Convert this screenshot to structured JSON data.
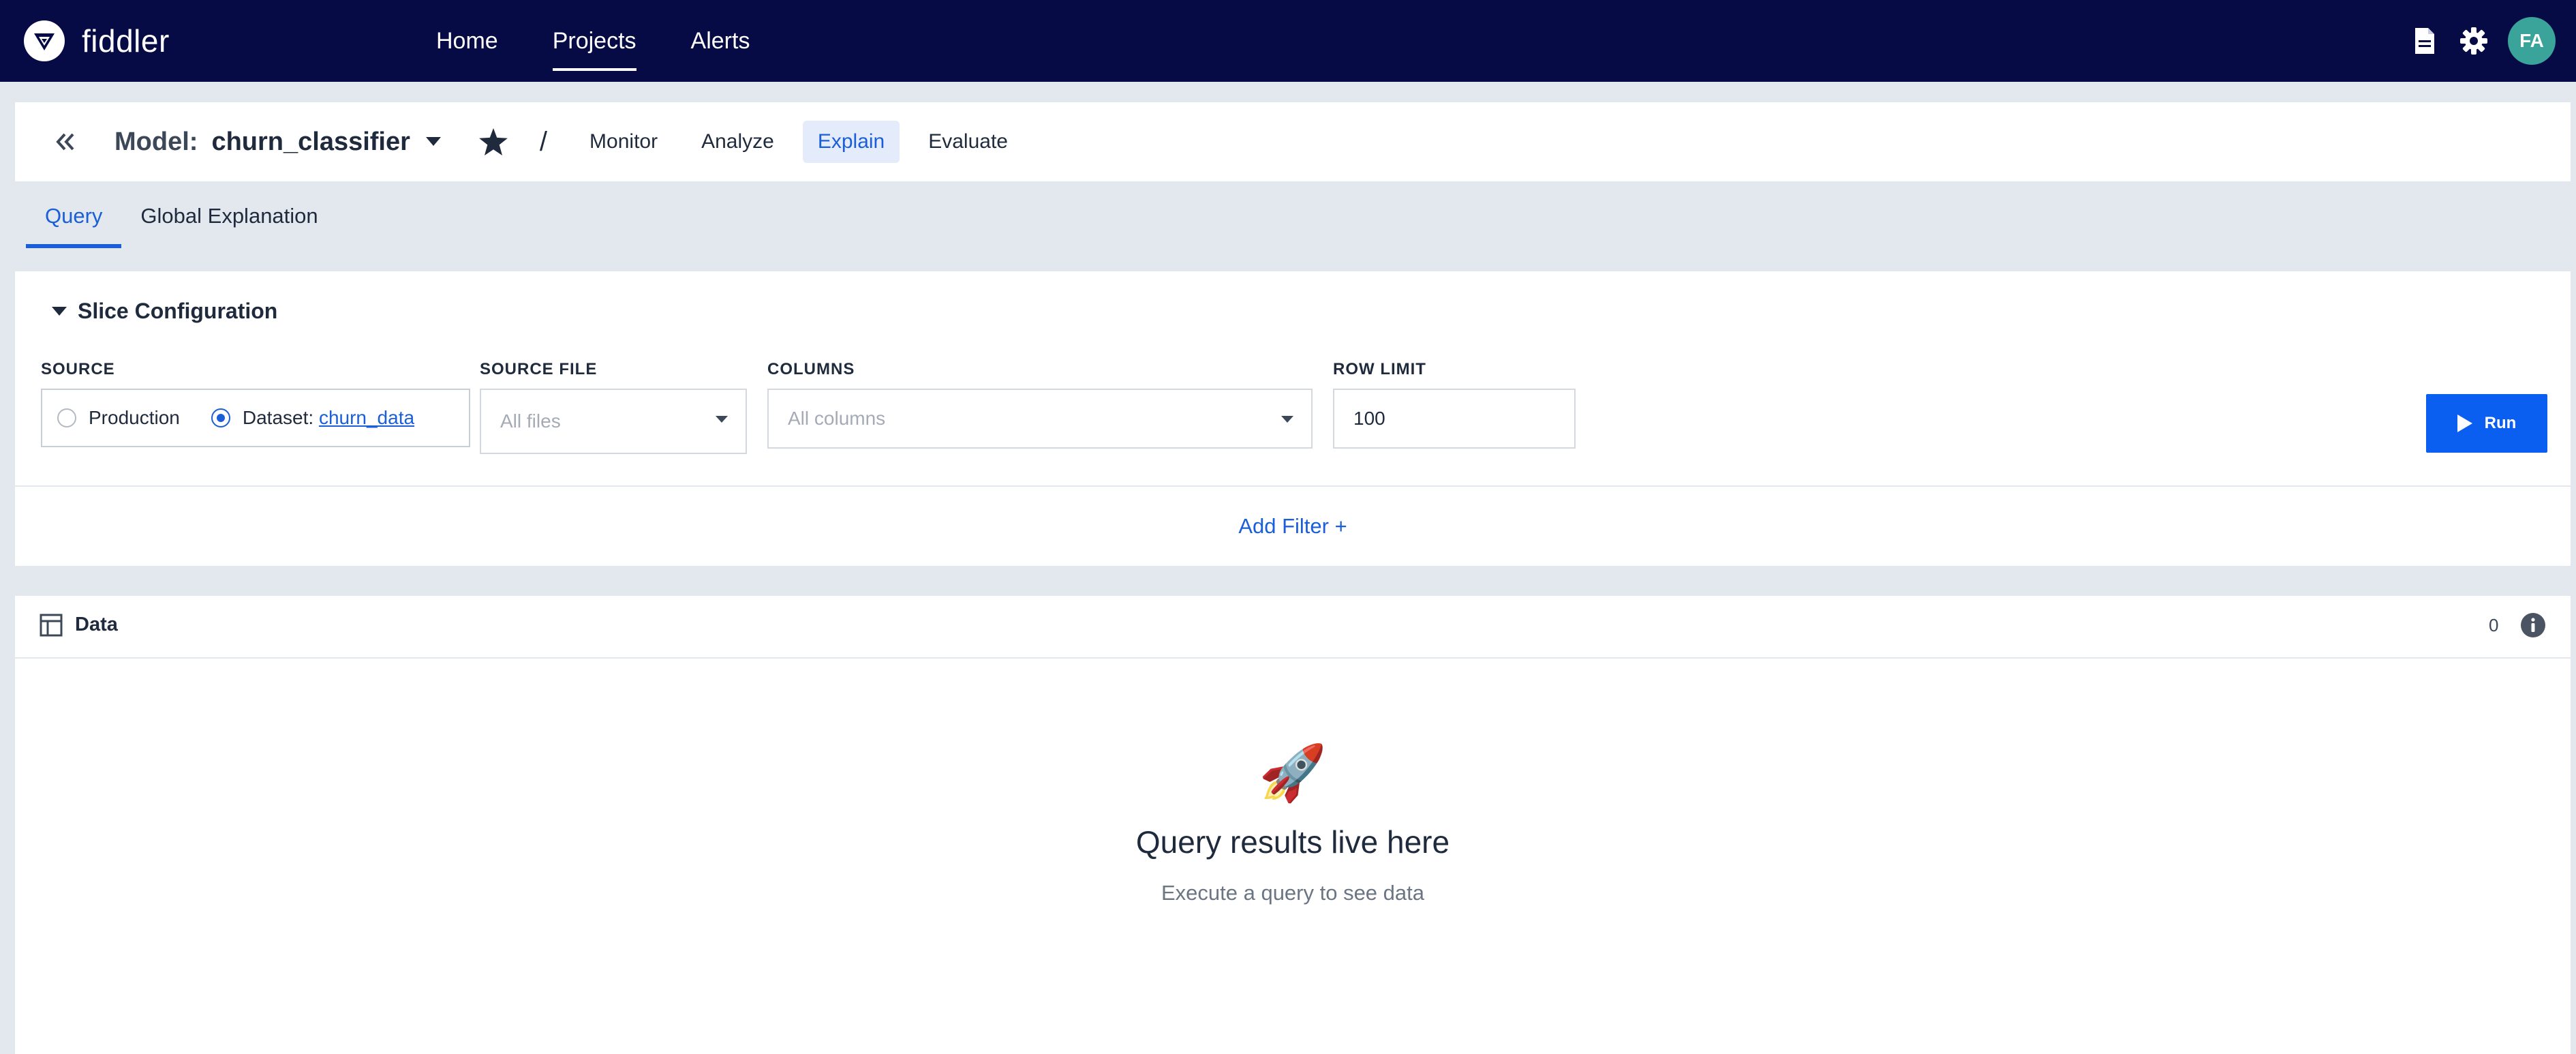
{
  "brand": {
    "name": "fiddler"
  },
  "topnav": {
    "links": [
      {
        "label": "Home"
      },
      {
        "label": "Projects"
      },
      {
        "label": "Alerts"
      }
    ],
    "avatar_initials": "FA"
  },
  "model_bar": {
    "label": "Model:",
    "name": "churn_classifier",
    "separator": "/",
    "tabs": [
      {
        "label": "Monitor"
      },
      {
        "label": "Analyze"
      },
      {
        "label": "Explain"
      },
      {
        "label": "Evaluate"
      }
    ],
    "active_tab": "Explain"
  },
  "subtabs": [
    {
      "label": "Query"
    },
    {
      "label": "Global Explanation"
    }
  ],
  "slice": {
    "title": "Slice Configuration",
    "source_label": "SOURCE",
    "source_options": {
      "production": "Production",
      "dataset_prefix": "Dataset: ",
      "dataset_name": "churn_data"
    },
    "source_file_label": "SOURCE FILE",
    "source_file_placeholder": "All files",
    "columns_label": "COLUMNS",
    "columns_placeholder": "All columns",
    "row_limit_label": "ROW LIMIT",
    "row_limit_value": "100",
    "run_label": "Run",
    "add_filter_label": "Add Filter  +"
  },
  "data_panel": {
    "title": "Data",
    "count": "0",
    "empty_icon": "🚀",
    "empty_title": "Query results live here",
    "empty_subtitle": "Execute a query to see data"
  },
  "colors": {
    "nav_bg": "#070b45",
    "accent": "#1a5fd8",
    "run_button": "#0b5ff0",
    "avatar": "#3aa39a",
    "page_bg": "#e3e8ef"
  }
}
